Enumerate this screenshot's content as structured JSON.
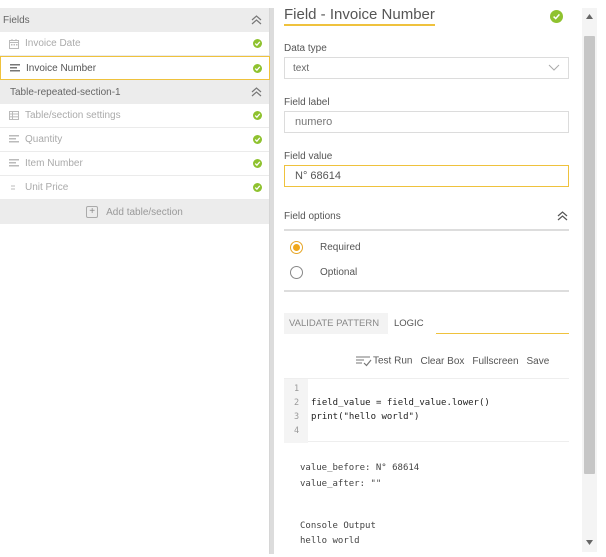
{
  "left_panel": {
    "fields_section": {
      "title": "Fields",
      "items": [
        {
          "label": "Invoice Date",
          "icon": "calendar-icon",
          "active": false
        },
        {
          "label": "Invoice Number",
          "icon": "text-lines-icon",
          "active": true
        }
      ]
    },
    "table_section": {
      "title": "Table-repeated-section-1",
      "items": [
        {
          "label": "Table/section settings",
          "icon": "table-icon"
        },
        {
          "label": "Quantity",
          "icon": "text-lines-icon"
        },
        {
          "label": "Item Number",
          "icon": "text-lines-icon"
        },
        {
          "label": "Unit Price",
          "icon": "number-icon"
        }
      ],
      "add_label": "Add table/section"
    }
  },
  "field_editor": {
    "title": "Field - Invoice Number",
    "data_type": {
      "label": "Data type",
      "value": "text"
    },
    "field_label": {
      "label": "Field label",
      "value": "numero"
    },
    "field_value": {
      "label": "Field value",
      "value": "N° 68614"
    },
    "field_options": {
      "label": "Field options",
      "options": [
        "Required",
        "Optional"
      ],
      "selected": "Required"
    },
    "tabs": [
      {
        "label": "VALIDATE PATTERN",
        "active": false
      },
      {
        "label": "LOGIC",
        "active": true
      }
    ],
    "toolbar": {
      "test_run": "Test Run",
      "clear_box": "Clear Box",
      "fullscreen": "Fullscreen",
      "save": "Save"
    },
    "code_lines": [
      {
        "num": "1",
        "text": ""
      },
      {
        "num": "2",
        "text": "field_value = field_value.lower()"
      },
      {
        "num": "3",
        "text": "print(\"hello world\")"
      },
      {
        "num": "4",
        "text": ""
      }
    ],
    "output": {
      "value_before": "value_before: N° 68614",
      "value_after": "value_after: \"\"",
      "console_title": "Console Output",
      "console_text": "hello world"
    }
  },
  "colors": {
    "accent": "#efc23d",
    "check_green": "#8fc22f",
    "radio_orange": "#f0a71a",
    "section_bg": "#ececec"
  }
}
